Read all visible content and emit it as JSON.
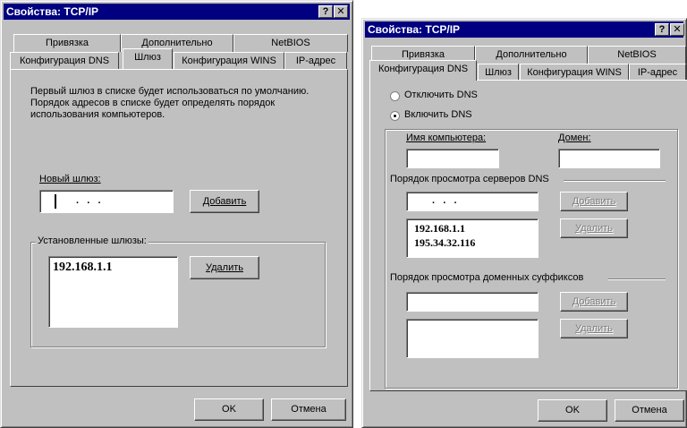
{
  "left": {
    "title": "Свойства: TCP/IP",
    "tabs_back": [
      "Привязка",
      "Дополнительно",
      "NetBIOS"
    ],
    "tabs_front": [
      "Конфигурация DNS",
      "Шлюз",
      "Конфигурация WINS",
      "IP-адрес"
    ],
    "description": "Первый шлюз в списке будет использоваться по умолчанию. Порядок адресов в списке будет определять порядок использования компьютеров.",
    "new_gateway_label": "Новый шлюз:",
    "ip_placeholder": ".   .   .",
    "add_button": "Добавить",
    "installed_label": "Установленные шлюзы:",
    "installed_items": [
      "192.168.1.1"
    ],
    "remove_button": "Удалить",
    "ok": "OK",
    "cancel": "Отмена"
  },
  "right": {
    "title": "Свойства: TCP/IP",
    "tabs_back": [
      "Привязка",
      "Дополнительно",
      "NetBIOS"
    ],
    "tabs_front": [
      "Конфигурация DNS",
      "Шлюз",
      "Конфигурация WINS",
      "IP-адрес"
    ],
    "radio_off": "Отключить DNS",
    "radio_on": "Включить DNS",
    "host_label": "Имя компьютера:",
    "domain_label": "Домен:",
    "dns_order_label": "Порядок просмотра серверов DNS",
    "ip_placeholder": ".   .   .",
    "add_button": "Добавить",
    "dns_servers": [
      "192.168.1.1",
      "195.34.32.116"
    ],
    "remove_button": "Удалить",
    "suffix_label": "Порядок просмотра доменных суффиксов",
    "add_button2": "Добавить",
    "remove_button2": "Удалить",
    "ok": "OK",
    "cancel": "Отмена"
  }
}
